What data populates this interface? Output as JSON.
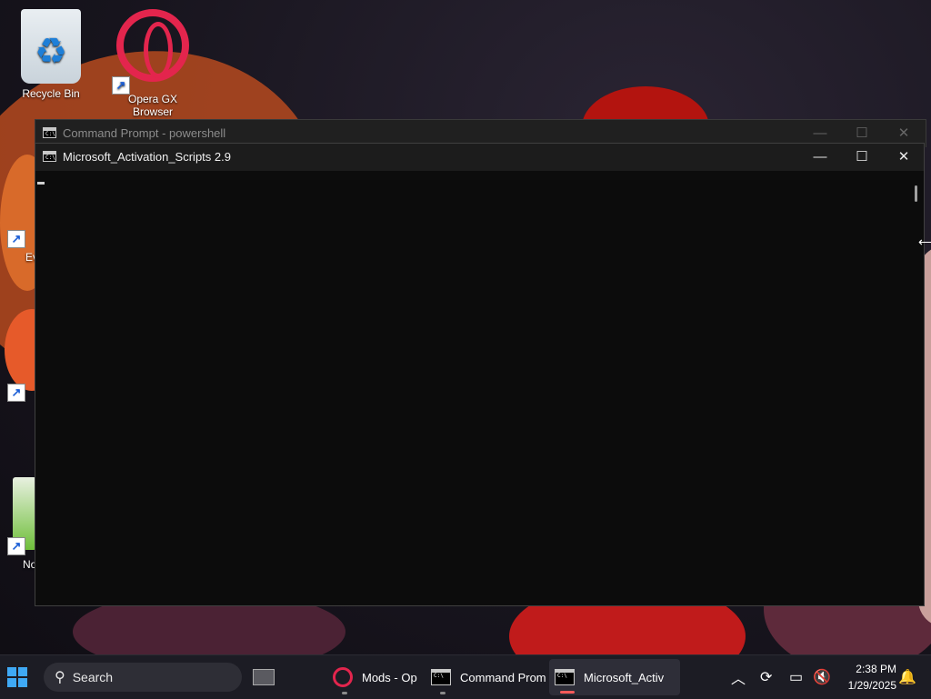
{
  "desktop": {
    "icons": [
      {
        "label": "Recycle Bin"
      },
      {
        "label": "Opera GX Browser"
      }
    ],
    "partial_labels": [
      "Ev",
      "No"
    ]
  },
  "back_window": {
    "title": "Command Prompt - powershell"
  },
  "front_window": {
    "title": "Microsoft_Activation_Scripts 2.9",
    "console_text": ""
  },
  "window_controls": {
    "minimize": "—",
    "maximize": "☐",
    "close": "✕"
  },
  "taskbar": {
    "search_label": "Search",
    "apps": [
      {
        "label": "Mods - Op",
        "icon": "opera-gx-icon"
      },
      {
        "label": "Command Prom",
        "icon": "command-prompt-icon"
      },
      {
        "label": "Microsoft_Activ",
        "icon": "command-prompt-icon",
        "active": true
      }
    ],
    "clock": {
      "time": "2:38 PM",
      "date": "1/29/2025"
    }
  },
  "colors": {
    "accent": "#3fa9f5",
    "opera_red": "#e3254d",
    "console_bg": "#0c0c0c"
  }
}
